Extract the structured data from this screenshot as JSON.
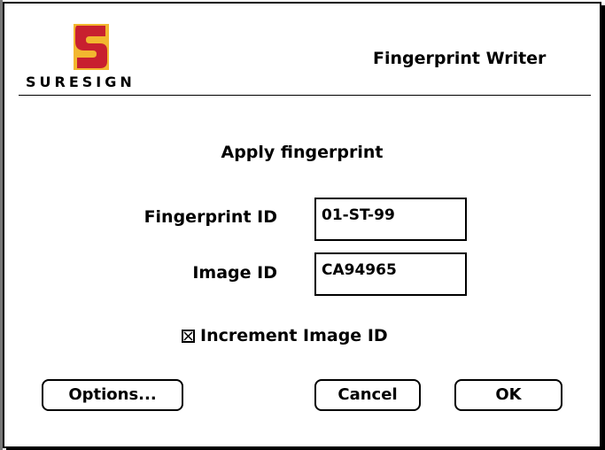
{
  "window": {
    "brand": "SURESIGN",
    "title": "Fingerprint Writer"
  },
  "dialog": {
    "heading": "Apply fingerprint",
    "fields": {
      "fingerprint_label": "Fingerprint ID",
      "fingerprint_value": "01-ST-99",
      "image_label": "Image ID",
      "image_value": "CA94965"
    },
    "checkbox": {
      "label": "Increment Image ID",
      "checked": true
    },
    "buttons": {
      "options": "Options...",
      "cancel": "Cancel",
      "ok": "OK"
    }
  },
  "colors": {
    "logo_yellow": "#f2b72f",
    "logo_red": "#c8202f"
  },
  "icons": {
    "logo": "suresign-logo",
    "checkbox": "checkbox-checked-icon"
  }
}
